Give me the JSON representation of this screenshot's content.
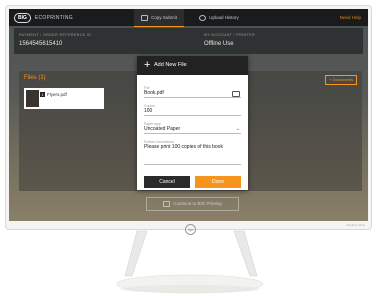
{
  "app": {
    "brand_logo": "BIG",
    "brand_text": "ECOPRINTING",
    "tabs": [
      {
        "label": "Copy Submit",
        "active": true
      },
      {
        "label": "Upload History",
        "active": false
      }
    ],
    "help_link": "Need Help"
  },
  "order": {
    "number_label": "PAYMENT / ORDER REFERENCE ID",
    "number_value": "1564545615410",
    "status_label": "MY ACCOUNT / PRINTER",
    "status_value": "Offline Use"
  },
  "files": {
    "title": "Files (1)",
    "add_label": "Documents",
    "items": [
      {
        "badge": "1",
        "name": "Flyers.pdf"
      }
    ]
  },
  "continue_label": "Continue to BIG Printing",
  "modal": {
    "title": "Add New File",
    "file_label": "File",
    "file_value": "Book.pdf",
    "copies_label": "Copies",
    "copies_value": "100",
    "paper_label": "Paper type",
    "paper_value": "Uncoated Paper",
    "instructions_label": "Further instructions",
    "instructions_value": "Please print 100 copies of this book",
    "cancel_label": "Cancel",
    "done_label": "Done"
  },
  "monitor": {
    "logo": "hp",
    "model": "Pavilion 22xw"
  },
  "colors": {
    "accent": "#f7941d",
    "header": "#191b1d"
  }
}
